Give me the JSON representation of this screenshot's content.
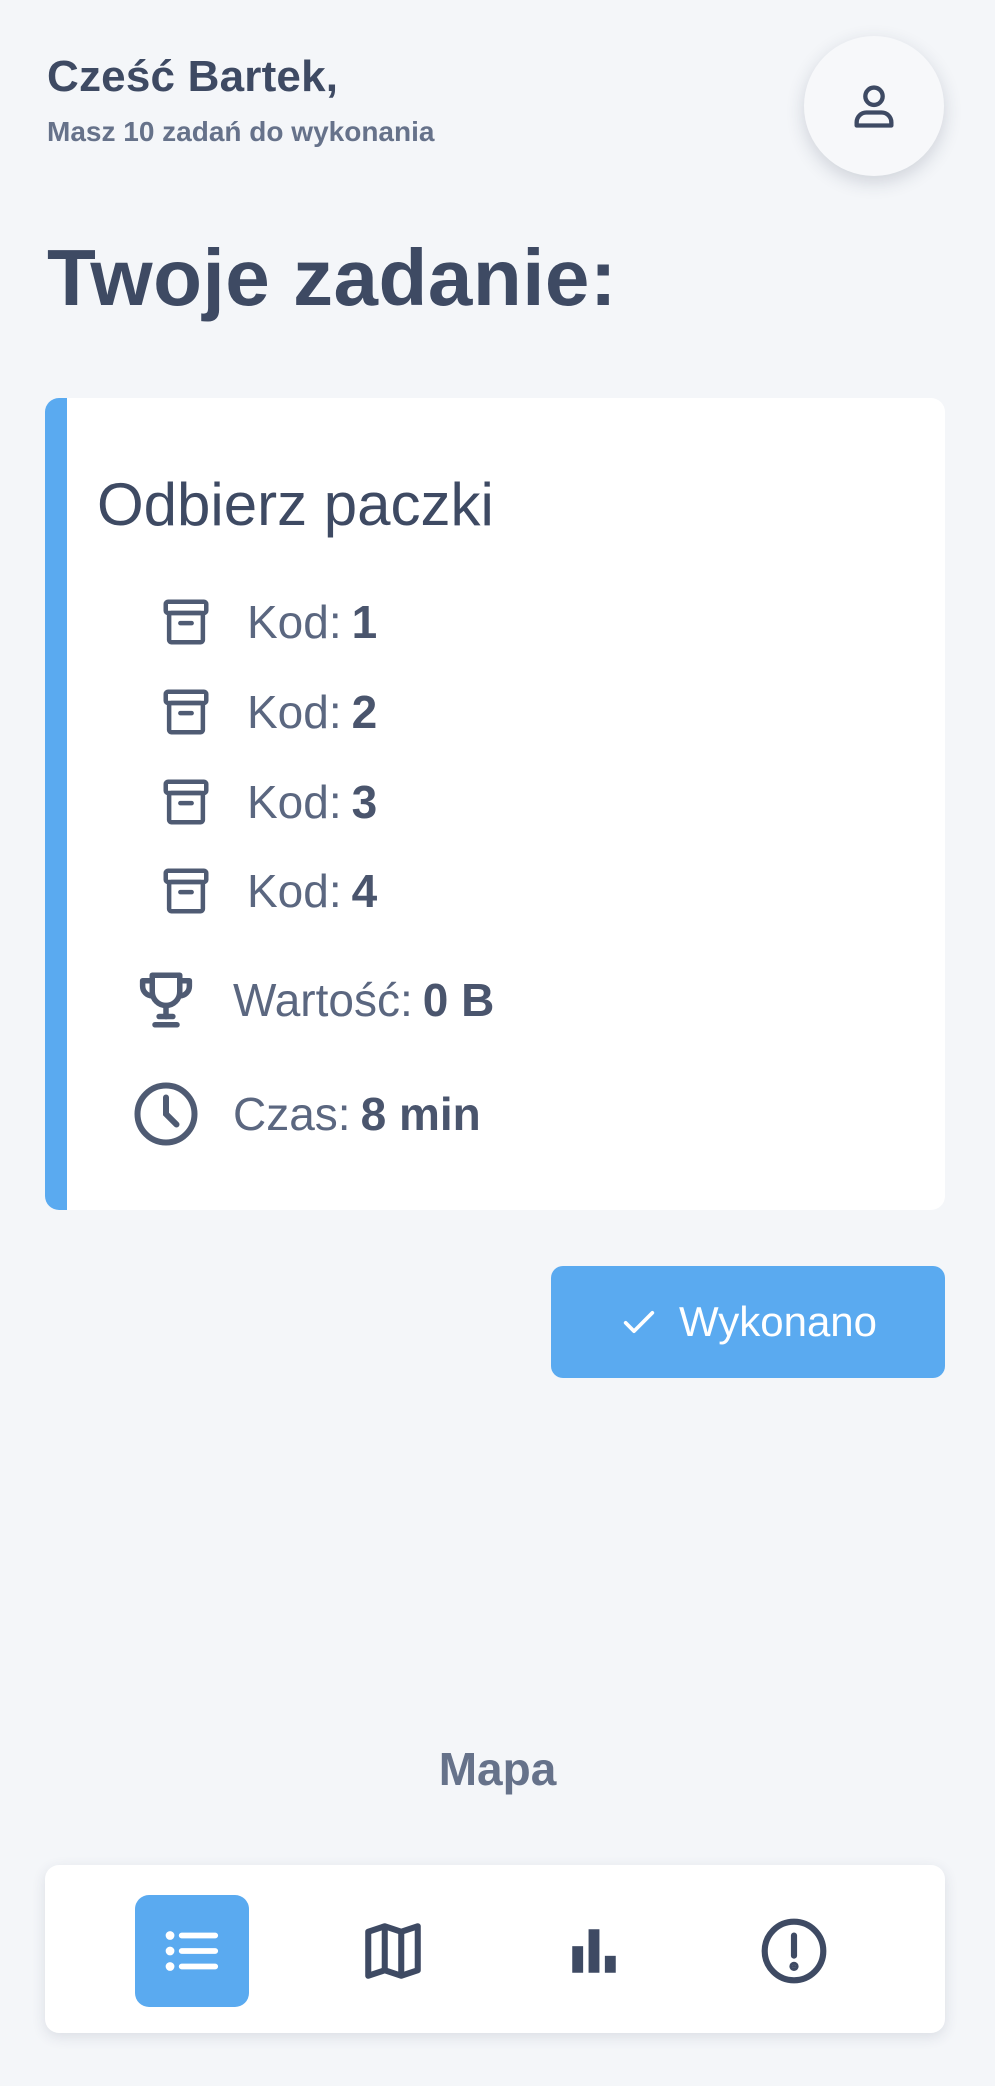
{
  "header": {
    "greeting": "Cześć Bartek,",
    "subtitle": "Masz 10 zadań do wykonania",
    "avatar_icon": "user-icon"
  },
  "section_title": "Twoje zadanie:",
  "task": {
    "title": "Odbierz paczki",
    "codes": [
      {
        "label": "Kod:",
        "value": "1",
        "icon": "archive-box-icon"
      },
      {
        "label": "Kod:",
        "value": "2",
        "icon": "archive-box-icon"
      },
      {
        "label": "Kod:",
        "value": "3",
        "icon": "archive-box-icon"
      },
      {
        "label": "Kod:",
        "value": "4",
        "icon": "archive-box-icon"
      }
    ],
    "value": {
      "label": "Wartość:",
      "amount": "0 B",
      "icon": "trophy-icon"
    },
    "time": {
      "label": "Czas:",
      "amount": "8 min",
      "icon": "clock-icon"
    },
    "accent_color": "#5aaaf0"
  },
  "done_button": {
    "label": "Wykonano",
    "icon": "check-icon"
  },
  "map_label": "Mapa",
  "bottom_nav": {
    "items": [
      {
        "icon": "list-icon",
        "active": true
      },
      {
        "icon": "map-icon",
        "active": false
      },
      {
        "icon": "bar-chart-icon",
        "active": false
      },
      {
        "icon": "alert-circle-icon",
        "active": false
      }
    ]
  },
  "colors": {
    "primary": "#5aaaf0",
    "text": "#3e4a63",
    "background": "#f4f6f9"
  }
}
